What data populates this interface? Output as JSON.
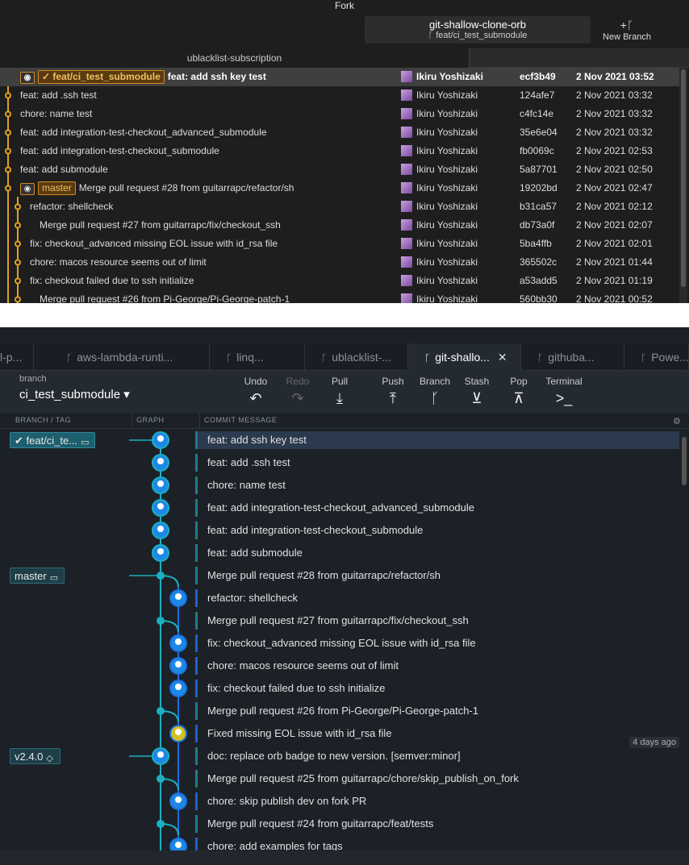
{
  "fork": {
    "title": "Fork",
    "repo_name": "git-shallow-clone-orb",
    "repo_branch": "ᚴ feat/ci_test_submodule",
    "new_branch_label": "New Branch",
    "tab_label": "ublacklist-subscription",
    "rows": [
      {
        "badges": [
          "feat/ci_test_submodule"
        ],
        "check": "✓",
        "message": "feat: add ssh key test",
        "author": "Ikiru Yoshizaki",
        "sha": "ecf3b49",
        "date": "2 Nov 2021 03:52",
        "selected": true
      },
      {
        "message": "feat: add .ssh test",
        "author": "Ikiru Yoshizaki",
        "sha": "124afe7",
        "date": "2 Nov 2021 03:32"
      },
      {
        "message": "chore: name test",
        "author": "Ikiru Yoshizaki",
        "sha": "c4fc14e",
        "date": "2 Nov 2021 03:32"
      },
      {
        "message": "feat: add integration-test-checkout_advanced_submodule",
        "author": "Ikiru Yoshizaki",
        "sha": "35e6e04",
        "date": "2 Nov 2021 03:32"
      },
      {
        "message": "feat: add integration-test-checkout_submodule",
        "author": "Ikiru Yoshizaki",
        "sha": "fb0069c",
        "date": "2 Nov 2021 02:53"
      },
      {
        "message": "feat: add submodule",
        "author": "Ikiru Yoshizaki",
        "sha": "5a87701",
        "date": "2 Nov 2021 02:50"
      },
      {
        "badges": [
          "master"
        ],
        "gh": true,
        "message": "Merge pull request #28 from guitarrapc/refactor/sh",
        "author": "Ikiru Yoshizaki",
        "sha": "19202bd",
        "date": "2 Nov 2021 02:47"
      },
      {
        "message": "refactor: shellcheck",
        "author": "Ikiru Yoshizaki",
        "sha": "b31ca57",
        "date": "2 Nov 2021 02:12",
        "indent": 12
      },
      {
        "message": "Merge pull request #27 from guitarrapc/fix/checkout_ssh",
        "author": "Ikiru Yoshizaki",
        "sha": "db73a0f",
        "date": "2 Nov 2021 02:07",
        "indent": 24
      },
      {
        "message": "fix: checkout_advanced missing EOL issue with id_rsa file",
        "author": "Ikiru Yoshizaki",
        "sha": "5ba4ffb",
        "date": "2 Nov 2021 02:01",
        "indent": 12
      },
      {
        "message": "chore: macos resource seems out of limit",
        "author": "Ikiru Yoshizaki",
        "sha": "365502c",
        "date": "2 Nov 2021 01:44",
        "indent": 12
      },
      {
        "message": "fix: checkout failed due to ssh initialize",
        "author": "Ikiru Yoshizaki",
        "sha": "a53add5",
        "date": "2 Nov 2021 01:19",
        "indent": 12
      },
      {
        "message": "Merge pull request #26 from Pi-George/Pi-George-patch-1",
        "author": "Ikiru Yoshizaki",
        "sha": "560bb30",
        "date": "2 Nov 2021 00:52",
        "indent": 24
      }
    ]
  },
  "kraken": {
    "tabs": [
      {
        "label": "l-p..."
      },
      {
        "label": "aws-lambda-runti..."
      },
      {
        "label": "linq..."
      },
      {
        "label": "ublacklist-..."
      },
      {
        "label": "git-shallo...",
        "active": true
      },
      {
        "label": "githuba..."
      },
      {
        "label": "Powe..."
      }
    ],
    "branch_label": "branch",
    "branch_name": "ci_test_submodule ▾",
    "toolbar": [
      {
        "label": "Undo",
        "icon": "↶"
      },
      {
        "label": "Redo",
        "icon": "↷",
        "disabled": true
      },
      {
        "label": "Pull",
        "icon": "⤓"
      },
      {
        "label": "Push",
        "icon": "⤒"
      },
      {
        "label": "Branch",
        "icon": "ᚴ"
      },
      {
        "label": "Stash",
        "icon": "⊻"
      },
      {
        "label": "Pop",
        "icon": "⊼"
      },
      {
        "label": "Terminal",
        "icon": ">_"
      }
    ],
    "columns": {
      "branch": "BRANCH / TAG",
      "graph": "GRAPH",
      "message": "COMMIT MESSAGE"
    },
    "rows": [
      {
        "message": "feat: add ssh key test",
        "tag": "✔ feat/ci_te...",
        "lane": 0,
        "selected": true
      },
      {
        "message": "feat: add .ssh test",
        "lane": 0
      },
      {
        "message": "chore: name test",
        "lane": 0
      },
      {
        "message": "feat: add integration-test-checkout_advanced_submodule",
        "lane": 0
      },
      {
        "message": "feat: add integration-test-checkout_submodule",
        "lane": 0
      },
      {
        "message": "feat: add submodule",
        "lane": 0
      },
      {
        "message": "Merge pull request #28 from guitarrapc/refactor/sh",
        "tag": "master",
        "lane": 0,
        "merge": true
      },
      {
        "message": "refactor: shellcheck",
        "lane": 1,
        "blue": true
      },
      {
        "message": "Merge pull request #27 from guitarrapc/fix/checkout_ssh",
        "lane": 0,
        "merge": true
      },
      {
        "message": "fix: checkout_advanced missing EOL issue with id_rsa file",
        "lane": 1,
        "blue": true
      },
      {
        "message": "chore: macos resource seems out of limit",
        "lane": 1,
        "blue": true
      },
      {
        "message": "fix: checkout failed due to ssh initialize",
        "lane": 1,
        "blue": true
      },
      {
        "message": "Merge pull request #26 from Pi-George/Pi-George-patch-1",
        "lane": 0,
        "merge": true
      },
      {
        "message": "Fixed missing EOL issue with id_rsa file",
        "lane": 1,
        "blue": true,
        "other": true
      },
      {
        "message": "doc: replace orb badge to new version. [semver:minor]",
        "tag": "v2.4.0",
        "lane": 0
      },
      {
        "message": "Merge pull request #25 from guitarrapc/chore/skip_publish_on_fork",
        "lane": 0,
        "merge": true
      },
      {
        "message": "chore: skip publish dev on fork PR",
        "lane": 1,
        "blue": true
      },
      {
        "message": "Merge pull request #24 from guitarrapc/feat/tests",
        "lane": 0,
        "merge": true
      },
      {
        "message": "chore: add examples for tags",
        "lane": 1,
        "blue": true
      }
    ],
    "ago": "4 days ago"
  }
}
